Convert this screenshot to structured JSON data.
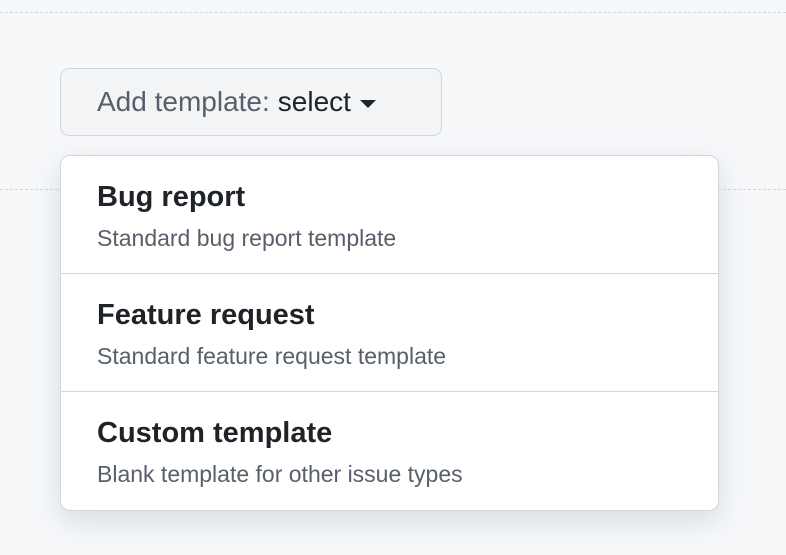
{
  "add_template": {
    "prefix": "Add template:",
    "value": "select",
    "caret_icon": "caret-down-icon"
  },
  "menu": {
    "items": [
      {
        "title": "Bug report",
        "description": "Standard bug report template"
      },
      {
        "title": "Feature request",
        "description": "Standard feature request template"
      },
      {
        "title": "Custom template",
        "description": "Blank template for other issue types"
      }
    ]
  }
}
